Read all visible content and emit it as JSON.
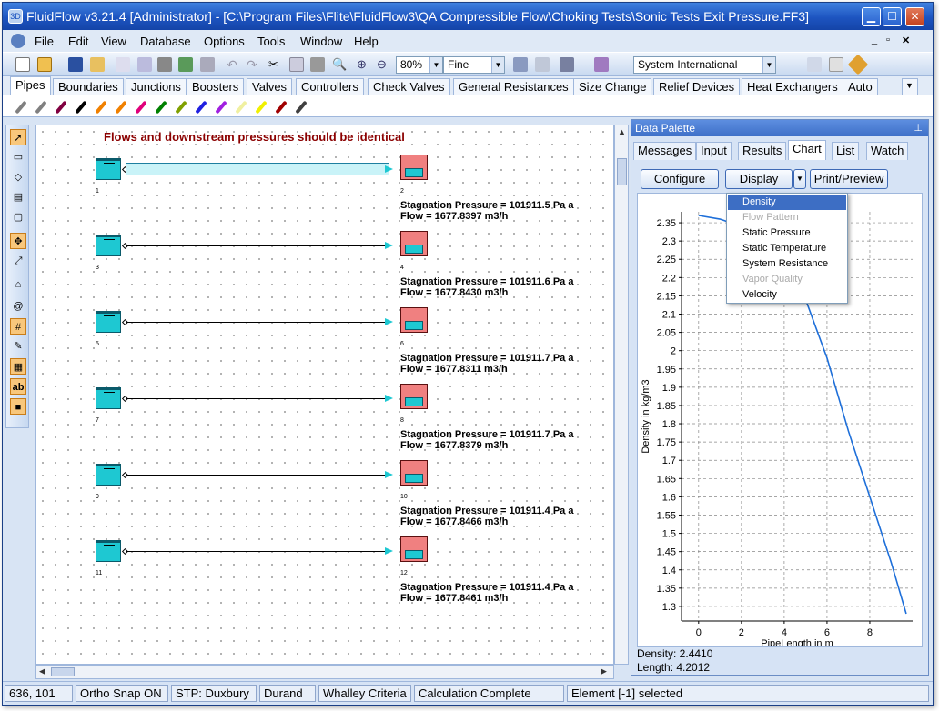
{
  "window": {
    "title": "FluidFlow v3.21.4 [Administrator] - [C:\\Program Files\\Flite\\FluidFlow3\\QA Compressible Flow\\Choking Tests\\Sonic Tests Exit Pressure.FF3]",
    "app_icon_label": "3D"
  },
  "menubar": {
    "items": [
      "File",
      "Edit",
      "View",
      "Database",
      "Options",
      "Tools",
      "Window",
      "Help"
    ],
    "mdi_controls": [
      "_",
      "▫",
      "✕"
    ]
  },
  "toolbar": {
    "zoom": "80%",
    "quality": "Fine",
    "units": "System International"
  },
  "component_tabs": [
    "Pipes",
    "Boundaries",
    "Junctions",
    "Boosters",
    "Valves",
    "Controllers",
    "Check Valves",
    "General Resistances",
    "Size Change",
    "Relief Devices",
    "Heat Exchangers",
    "Auto"
  ],
  "pipe_tool_colors": [
    "#808080",
    "#808080",
    "#800040",
    "#000000",
    "#f08000",
    "#f08000",
    "#e0007a",
    "#008000",
    "#80a000",
    "#2020e0",
    "#a020e0",
    "#f0f0a0",
    "#f0f000",
    "#a00000",
    "#404040"
  ],
  "canvas": {
    "title": "Flows and downstream pressures should be identical",
    "rows": [
      {
        "left_id": "1",
        "right_id": "2",
        "pressure": "Stagnation Pressure = 101911.5 Pa a",
        "flow": "Flow = 1677.8397 m3/h"
      },
      {
        "left_id": "3",
        "right_id": "4",
        "pressure": "Stagnation Pressure = 101911.6 Pa a",
        "flow": "Flow = 1677.8430 m3/h"
      },
      {
        "left_id": "5",
        "right_id": "6",
        "pressure": "Stagnation Pressure = 101911.7 Pa a",
        "flow": "Flow = 1677.8311 m3/h"
      },
      {
        "left_id": "7",
        "right_id": "8",
        "pressure": "Stagnation Pressure = 101911.7 Pa a",
        "flow": "Flow = 1677.8379 m3/h"
      },
      {
        "left_id": "9",
        "right_id": "10",
        "pressure": "Stagnation Pressure = 101911.4 Pa a",
        "flow": "Flow = 1677.8466 m3/h"
      },
      {
        "left_id": "11",
        "right_id": "12",
        "pressure": "Stagnation Pressure = 101911.4 Pa a",
        "flow": "Flow = 1677.8461 m3/h"
      }
    ]
  },
  "palette": {
    "title": "Data Palette",
    "tabs": [
      "Messages",
      "Input",
      "Results",
      "Chart",
      "List",
      "Watch"
    ],
    "active_tab": "Chart",
    "buttons": {
      "configure": "Configure",
      "display": "Display",
      "print": "Print/Preview"
    },
    "dropdown": [
      {
        "label": "Density",
        "state": "highlighted"
      },
      {
        "label": "Flow Pattern",
        "state": "disabled"
      },
      {
        "label": "Static Pressure",
        "state": "normal"
      },
      {
        "label": "Static Temperature",
        "state": "normal"
      },
      {
        "label": "System Resistance",
        "state": "normal"
      },
      {
        "label": "Vapor Quality",
        "state": "disabled"
      },
      {
        "label": "Velocity",
        "state": "normal"
      }
    ],
    "readout_density": "Density: 2.4410",
    "readout_length": "Length: 4.2012"
  },
  "chart_data": {
    "type": "line",
    "xlabel": "PipeLength in m",
    "ylabel": "Density in kg/m3",
    "xlim": [
      -0.8,
      10.0
    ],
    "ylim": [
      1.26,
      2.38
    ],
    "xticks": [
      0,
      2,
      4,
      6,
      8
    ],
    "yticks": [
      1.3,
      1.35,
      1.4,
      1.45,
      1.5,
      1.55,
      1.6,
      1.65,
      1.7,
      1.75,
      1.8,
      1.85,
      1.9,
      1.95,
      2,
      2.05,
      2.1,
      2.15,
      2.2,
      2.25,
      2.3,
      2.35
    ],
    "grid": true,
    "series": [
      {
        "color": "#1e6fd9",
        "x": [
          0,
          1,
          2,
          3,
          4,
          5,
          6,
          7,
          8,
          9,
          9.7
        ],
        "y": [
          2.37,
          2.36,
          2.34,
          2.3,
          2.24,
          2.14,
          1.98,
          1.78,
          1.6,
          1.42,
          1.28
        ]
      }
    ]
  },
  "statusbar": [
    "636, 101",
    "Ortho Snap ON",
    "STP: Duxbury",
    "Durand",
    "Whalley Criteria",
    "Calculation Complete",
    "Element [-1] selected"
  ]
}
